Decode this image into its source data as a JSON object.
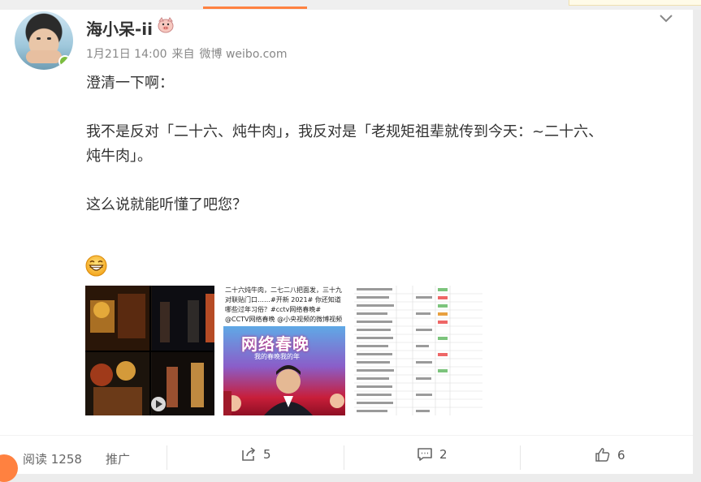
{
  "post": {
    "username": "海小呆-ii",
    "date": "1月21日 14:00",
    "source_prefix": "来自",
    "source": "微博 weibo.com",
    "lines": [
      "澄清一下啊：",
      "我不是反对「二十六、炖牛肉」，我反对是「老规矩祖辈就传到今天：~二十六、",
      "炖牛肉」。",
      "这么说就能听懂了吧您？"
    ],
    "thumb2_caption": "二十六炖牛肉，二七二八把面发，三十九对联贴门口……#开新 2021# 你还知道哪些过年习俗？#cctv网络春晚# @CCTV网络春晚 @小央视频的微博视频",
    "thumb2_banner": "网络春晚",
    "thumb2_sub": "我的春晚我的年"
  },
  "footer": {
    "read_label": "阅读 1258",
    "promote_label": "推广",
    "share_count": "5",
    "comment_count": "2",
    "like_count": "6"
  },
  "colors": {
    "accent": "#ff8140",
    "meta": "#888888"
  }
}
